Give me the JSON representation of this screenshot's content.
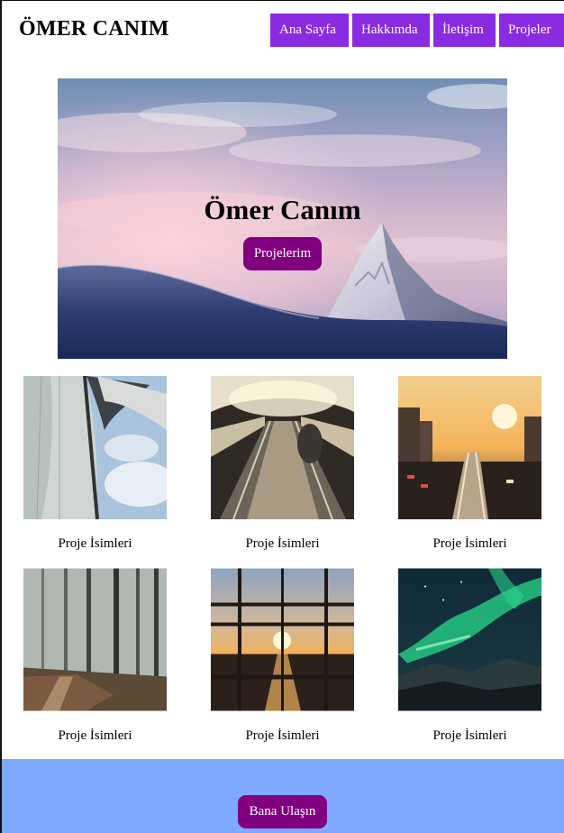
{
  "header": {
    "brand": "ÖMER CANIM",
    "nav": [
      "Ana Sayfa",
      "Hakkımda",
      "İletişim",
      "Projeler"
    ]
  },
  "hero": {
    "title": "Ömer Canım",
    "button": "Projelerim"
  },
  "projects": [
    {
      "caption": "Proje İsimleri"
    },
    {
      "caption": "Proje İsimleri"
    },
    {
      "caption": "Proje İsimleri"
    },
    {
      "caption": "Proje İsimleri"
    },
    {
      "caption": "Proje İsimleri"
    },
    {
      "caption": "Proje İsimleri"
    }
  ],
  "footer": {
    "button": "Bana Ulaşın"
  },
  "colors": {
    "nav_bg": "#8a2be2",
    "button_bg": "#800080",
    "footer_bg": "#7fa9ff"
  }
}
